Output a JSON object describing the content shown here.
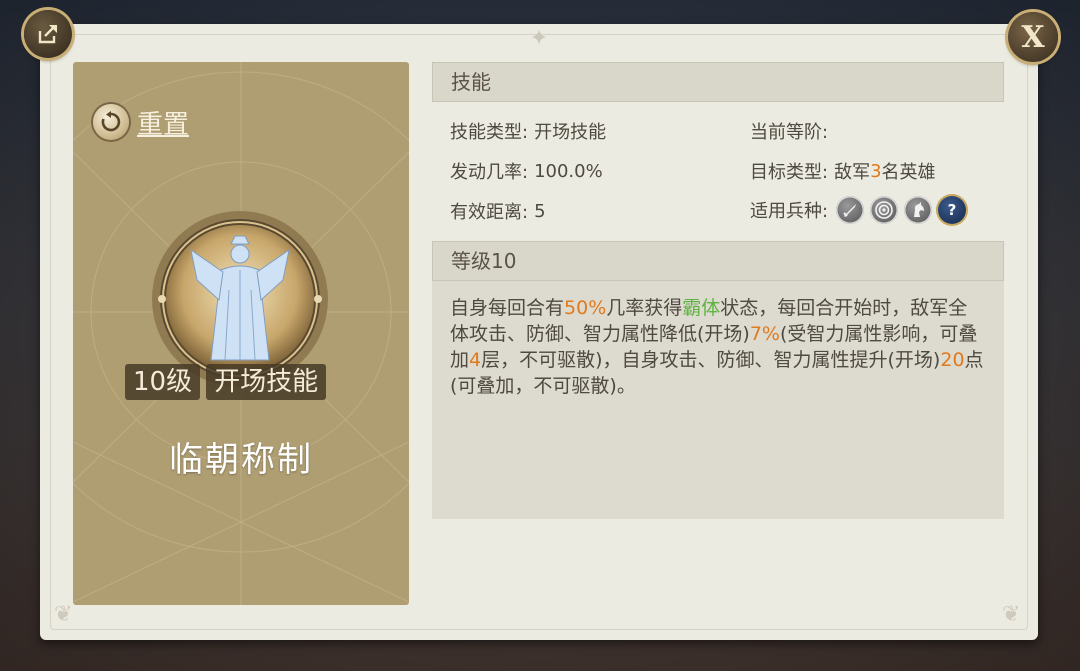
{
  "reset_label": "重置",
  "skill": {
    "level_tag": "10级",
    "type_tag": "开场技能",
    "name": "临朝称制"
  },
  "skills_section": {
    "title": "技能",
    "skill_type_label": "技能类型:",
    "skill_type_value": "开场技能",
    "current_rank_label": "当前等阶:",
    "trigger_rate_label": "发动几率:",
    "trigger_rate_value": "100.0%",
    "target_type_label": "目标类型:",
    "target_prefix": "敌军",
    "target_count": "3",
    "target_suffix": "名英雄",
    "range_label": "有效距离:",
    "range_value": "5",
    "unit_types_label": "适用兵种:",
    "unit_icons": [
      "sword-icon",
      "bow-target-icon",
      "cavalry-horse-icon",
      "question-icon"
    ]
  },
  "level_section": {
    "title": "等级10",
    "desc": {
      "p1": "自身每回合有",
      "v1": "50%",
      "p2": "几率获得",
      "v2": "霸体",
      "p3": "状态，每回合开始时，敌军全体攻击、防御、智力属性降低(开场)",
      "v3": "7%",
      "p4": "(受智力属性影响，可叠加",
      "v4": "4",
      "p5": "层，不可驱散)，自身攻击、防御、智力属性提升(开场)",
      "v5": "20",
      "p6": "点(可叠加，不可驱散)。"
    }
  },
  "colors": {
    "highlight_orange": "#e07a1d",
    "highlight_green": "#5fb341",
    "card_background": "#b09e73"
  }
}
